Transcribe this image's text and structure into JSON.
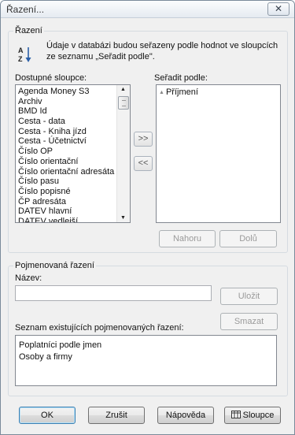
{
  "window": {
    "title": "Řazení..."
  },
  "sort_group": {
    "legend": "Řazení",
    "description": "Údaje v databázi budou seřazeny podle hodnot ve sloupcích ze seznamu „Seřadit podle\"."
  },
  "available": {
    "label": "Dostupné sloupce:",
    "items": [
      "Agenda Money S3",
      "Archiv",
      "BMD Id",
      "Cesta - data",
      "Cesta - Kniha jízd",
      "Cesta - Účetnictví",
      "Číslo OP",
      "Číslo orientační",
      "Číslo orientační adresáta",
      "Číslo pasu",
      "Číslo popisné",
      "ČP adresáta",
      "DATEV hlavní",
      "DATEV vedlejší"
    ]
  },
  "sort_by": {
    "label": "Seřadit podle:",
    "items": [
      {
        "text": "Příjmení",
        "direction_icon": "ascending-triangle-icon"
      }
    ]
  },
  "move": {
    "add_label": ">>",
    "remove_label": "<<"
  },
  "order_buttons": {
    "up_label": "Nahoru",
    "down_label": "Dolů"
  },
  "named_group": {
    "legend": "Pojmenovaná řazení",
    "name_label": "Název:",
    "name_value": "",
    "save_label": "Uložit",
    "delete_label": "Smazat",
    "list_label": "Seznam existujících pojmenovaných řazení:",
    "items": [
      "Poplatníci podle jmen",
      "Osoby a firmy"
    ]
  },
  "footer": {
    "ok_label": "OK",
    "cancel_label": "Zrušit",
    "help_label": "Nápověda",
    "columns_label": "Sloupce"
  }
}
